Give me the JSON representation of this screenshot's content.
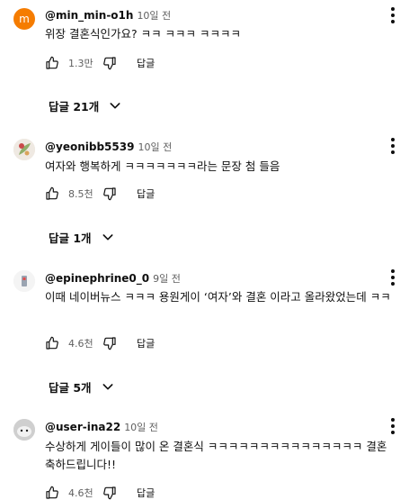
{
  "comments": [
    {
      "author": "@min_min-o1h",
      "time": "10일 전",
      "avatar_letter": "m",
      "avatar_color": "#f57c00",
      "text": "위장 결혼식인가요? ㅋㅋ ㅋㅋㅋ ㅋㅋㅋㅋ",
      "likes": "1.3만",
      "reply_label": "답글",
      "replies_label": "답글 21개"
    },
    {
      "author": "@yeonibb5539",
      "time": "10일 전",
      "text": "여자와 행복하게 ㅋㅋㅋㅋㅋㅋㅋ라는 문장 첨 들음",
      "likes": "8.5천",
      "reply_label": "답글",
      "replies_label": "답글 1개"
    },
    {
      "author": "@epinephrine0_0",
      "time": "9일 전",
      "text": "이때 네이버뉴스 ㅋㅋㅋ 용원게이 ‘여자’와 결혼 이라고 올라왔었는데 ㅋㅋ",
      "likes": "4.6천",
      "reply_label": "답글",
      "replies_label": "답글 5개"
    },
    {
      "author": "@user-ina22",
      "time": "10일 전",
      "text": "수상하게 게이들이 많이 온 결혼식 ㅋㅋㅋㅋㅋㅋㅋㅋㅋㅋㅋㅋㅋㅋㅋ 결혼 축하드립니다!!",
      "likes": "4.6천",
      "reply_label": "답글"
    }
  ],
  "icons": {
    "like": "thumb-up-icon",
    "dislike": "thumb-down-icon",
    "more": "more-vert-icon",
    "expand": "chevron-down-icon"
  }
}
